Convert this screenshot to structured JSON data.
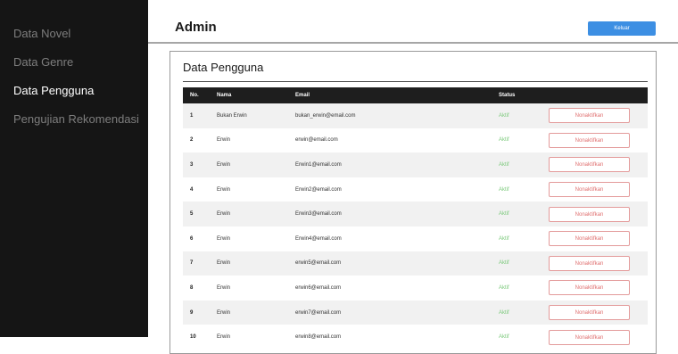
{
  "sidebar": {
    "items": [
      {
        "label": "Data Novel",
        "active": false
      },
      {
        "label": "Data Genre",
        "active": false
      },
      {
        "label": "Data Pengguna",
        "active": true
      },
      {
        "label": "Pengujian Rekomendasi",
        "active": false
      }
    ]
  },
  "header": {
    "title": "Admin",
    "logout_label": "Keluar"
  },
  "panel": {
    "title": "Data Pengguna"
  },
  "table": {
    "columns": [
      "No.",
      "Nama",
      "Email",
      "Status",
      ""
    ],
    "rows": [
      {
        "no": "1",
        "nama": "Bukan Erwin",
        "email": "bukan_erwin@email.com",
        "status": "Aktif",
        "action": "Nonaktifkan"
      },
      {
        "no": "2",
        "nama": "Erwin",
        "email": "erwin@email.com",
        "status": "Aktif",
        "action": "Nonaktifkan"
      },
      {
        "no": "3",
        "nama": "Erwin",
        "email": "Erwin1@email.com",
        "status": "Aktif",
        "action": "Nonaktifkan"
      },
      {
        "no": "4",
        "nama": "Erwin",
        "email": "Erwin2@email.com",
        "status": "Aktif",
        "action": "Nonaktifkan"
      },
      {
        "no": "5",
        "nama": "Erwin",
        "email": "Erwin3@email.com",
        "status": "Aktif",
        "action": "Nonaktifkan"
      },
      {
        "no": "6",
        "nama": "Erwin",
        "email": "Erwin4@email.com",
        "status": "Aktif",
        "action": "Nonaktifkan"
      },
      {
        "no": "7",
        "nama": "Erwin",
        "email": "erwin5@email.com",
        "status": "Aktif",
        "action": "Nonaktifkan"
      },
      {
        "no": "8",
        "nama": "Erwin",
        "email": "erwin6@email.com",
        "status": "Aktif",
        "action": "Nonaktifkan"
      },
      {
        "no": "9",
        "nama": "Erwin",
        "email": "erwin7@email.com",
        "status": "Aktif",
        "action": "Nonaktifkan"
      },
      {
        "no": "10",
        "nama": "Erwin",
        "email": "erwin8@email.com",
        "status": "Aktif",
        "action": "Nonaktifkan"
      }
    ]
  },
  "colors": {
    "sidebar_bg": "#151515",
    "accent_button": "#3d8fe3",
    "status_active": "#7cc97c",
    "deactivate_border": "#e39a9a"
  }
}
